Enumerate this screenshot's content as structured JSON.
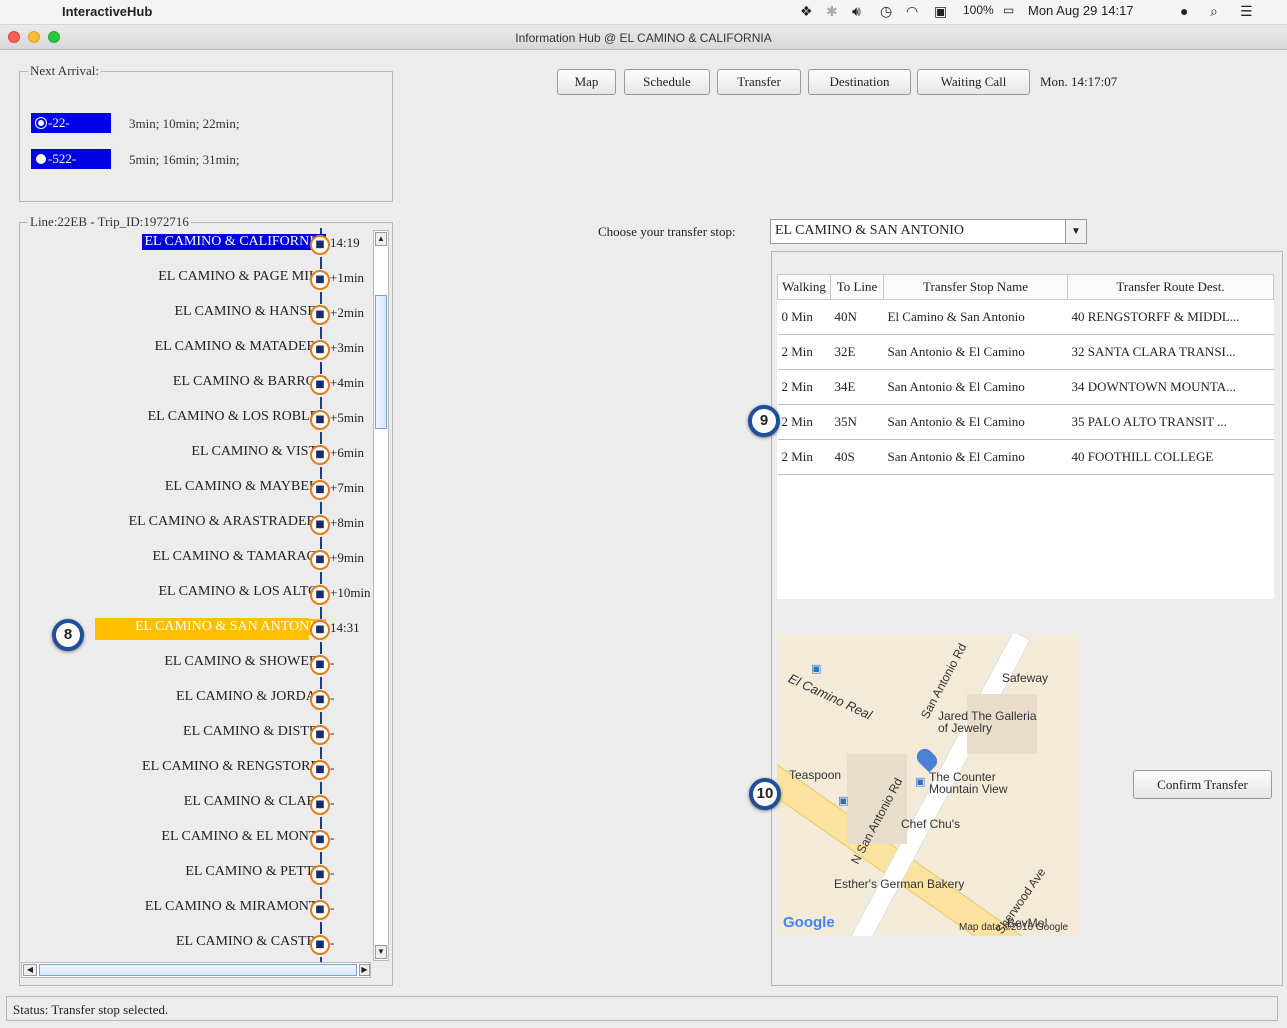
{
  "menubar": {
    "app_name": "InteractiveHub",
    "battery": "100%",
    "clock": "Mon Aug 29 14:17"
  },
  "window": {
    "title": "Information Hub @ EL CAMINO & CALIFORNIA"
  },
  "next_arrival": {
    "legend": "Next Arrival:",
    "routes": [
      {
        "route": "-22-",
        "times": "3min; 10min; 22min;"
      },
      {
        "route": "-522-",
        "times": "5min; 16min; 31min;"
      }
    ]
  },
  "toolbar": {
    "buttons": [
      "Map",
      "Schedule",
      "Transfer",
      "Destination",
      "Waiting Call"
    ],
    "clock": "Mon. 14:17:07"
  },
  "trip": {
    "legend": "Line:22EB - Trip_ID:1972716",
    "stops": [
      {
        "name": "EL CAMINO & CALIFORNIA",
        "time": "14:19"
      },
      {
        "name": "EL CAMINO & PAGE MILL",
        "time": "+1min"
      },
      {
        "name": "EL CAMINO & HANSEN",
        "time": "+2min"
      },
      {
        "name": "EL CAMINO & MATADERO",
        "time": "+3min"
      },
      {
        "name": "EL CAMINO & BARRON",
        "time": "+4min"
      },
      {
        "name": "EL CAMINO & LOS ROBLES",
        "time": "+5min"
      },
      {
        "name": "EL CAMINO & VISTA",
        "time": "+6min"
      },
      {
        "name": "EL CAMINO & MAYBELL",
        "time": "+7min"
      },
      {
        "name": "EL CAMINO & ARASTRADERO",
        "time": "+8min"
      },
      {
        "name": "EL CAMINO & TAMARACK",
        "time": "+9min"
      },
      {
        "name": "EL CAMINO & LOS ALTOS",
        "time": "+10min"
      },
      {
        "name": "EL CAMINO & SAN ANTONIO",
        "time": "14:31"
      },
      {
        "name": "EL CAMINO & SHOWERS",
        "time": "-"
      },
      {
        "name": "EL CAMINO & JORDAN",
        "time": "-"
      },
      {
        "name": "EL CAMINO & DISTEL",
        "time": "-"
      },
      {
        "name": "EL CAMINO & RENGSTORFF",
        "time": "-"
      },
      {
        "name": "EL CAMINO & CLARK",
        "time": "-"
      },
      {
        "name": "EL CAMINO & EL MONTE",
        "time": "-"
      },
      {
        "name": "EL CAMINO & PETTIS",
        "time": "-"
      },
      {
        "name": "EL CAMINO & MIRAMONTE",
        "time": "-"
      },
      {
        "name": "EL CAMINO & CASTRO",
        "time": "-"
      }
    ]
  },
  "transfer": {
    "choose_label": "Choose your transfer stop:",
    "selected_stop": "EL CAMINO & SAN ANTONIO",
    "columns": [
      "Walking",
      "To Line",
      "Transfer Stop Name",
      "Transfer Route Dest."
    ],
    "rows": [
      [
        "0 Min",
        "40N",
        "El Camino & San Antonio",
        "40 RENGSTORFF & MIDDL..."
      ],
      [
        "2 Min",
        "32E",
        "San Antonio & El Camino",
        "32 SANTA CLARA TRANSI..."
      ],
      [
        "2 Min",
        "34E",
        "San Antonio & El Camino",
        "34 DOWNTOWN MOUNTA..."
      ],
      [
        "2 Min",
        "35N",
        "San Antonio & El Camino",
        "35 PALO ALTO TRANSIT ..."
      ],
      [
        "2 Min",
        "40S",
        "San Antonio & El Camino",
        "40 FOOTHILL COLLEGE"
      ]
    ],
    "confirm_label": "Confirm Transfer"
  },
  "map": {
    "labels": {
      "el_camino": "El Camino Real",
      "san_antonio": "San Antonio Rd",
      "n_san_antonio": "N San Antonio Rd",
      "sherwood": "Sherwood Ave",
      "safeway": "Safeway",
      "jared": "Jared The Galleria of Jewelry",
      "teaspoon": "Teaspoon",
      "counter": "The Counter Mountain View",
      "chef": "Chef Chu's",
      "esther": "Esther's German Bakery",
      "bevmo": "BevMo!",
      "google": "Google",
      "attribution": "Map data ©2016 Google"
    }
  },
  "markers": {
    "m8": "8",
    "m9": "9",
    "m10": "10"
  },
  "status": "Status: Transfer stop selected."
}
